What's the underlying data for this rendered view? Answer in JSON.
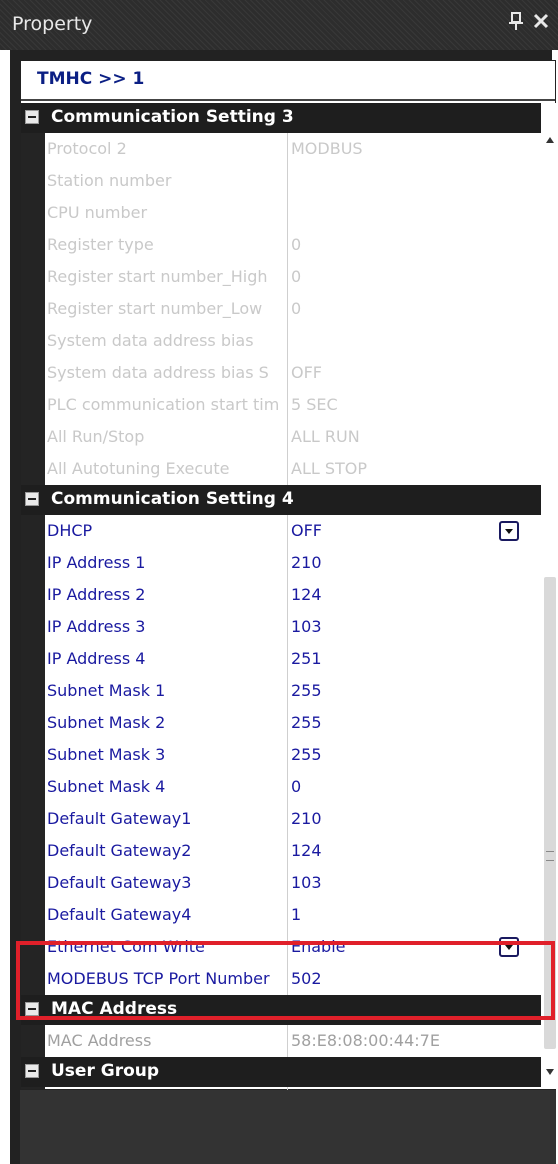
{
  "window": {
    "title": "Property",
    "pin_icon": "pin-icon",
    "close_icon": "close-icon"
  },
  "breadcrumb": "TMHC >> 1",
  "categories": [
    {
      "label": "Communication Setting 3",
      "state": "disabled",
      "rows": [
        {
          "name": "Protocol 2",
          "value": "MODBUS"
        },
        {
          "name": "Station number",
          "value": ""
        },
        {
          "name": "CPU number",
          "value": ""
        },
        {
          "name": "Register type",
          "value": "0"
        },
        {
          "name": "Register start number_High",
          "value": "0"
        },
        {
          "name": "Register start number_Low",
          "value": "0"
        },
        {
          "name": "System data address bias",
          "value": ""
        },
        {
          "name": "System data address bias S",
          "value": "OFF"
        },
        {
          "name": "PLC communication start tim",
          "value": "5 SEC"
        },
        {
          "name": "All Run/Stop",
          "value": "ALL RUN"
        },
        {
          "name": "All Autotuning Execute",
          "value": "ALL STOP"
        }
      ]
    },
    {
      "label": "Communication Setting 4",
      "state": "enabled",
      "rows": [
        {
          "name": "DHCP",
          "value": "OFF",
          "dropdown": true
        },
        {
          "name": "IP Address 1",
          "value": "210"
        },
        {
          "name": "IP Address 2",
          "value": "124"
        },
        {
          "name": "IP Address 3",
          "value": "103"
        },
        {
          "name": "IP Address 4",
          "value": "251"
        },
        {
          "name": "Subnet Mask 1",
          "value": "255"
        },
        {
          "name": "Subnet Mask 2",
          "value": "255"
        },
        {
          "name": "Subnet Mask 3",
          "value": "255"
        },
        {
          "name": "Subnet Mask 4",
          "value": "0"
        },
        {
          "name": "Default Gateway1",
          "value": "210"
        },
        {
          "name": "Default Gateway2",
          "value": "124"
        },
        {
          "name": "Default Gateway3",
          "value": "103"
        },
        {
          "name": "Default Gateway4",
          "value": "1"
        },
        {
          "name": "Ethernet Com Write",
          "value": "Enable",
          "dropdown": true
        },
        {
          "name": "MODEBUS TCP Port Number",
          "value": "502"
        }
      ]
    },
    {
      "label": "MAC Address",
      "state": "readonly",
      "rows": [
        {
          "name": "MAC Address",
          "value": "58:E8:08:00:44:7E"
        }
      ]
    },
    {
      "label": "User Group",
      "state": "enabled",
      "rows": [
        {
          "name": "",
          "value": ""
        }
      ]
    }
  ],
  "colors": {
    "highlight": "#e0202a",
    "enabled_text": "#1a1aa0",
    "disabled_text": "#c9c9c9",
    "header_bg": "#1e1e1e"
  }
}
